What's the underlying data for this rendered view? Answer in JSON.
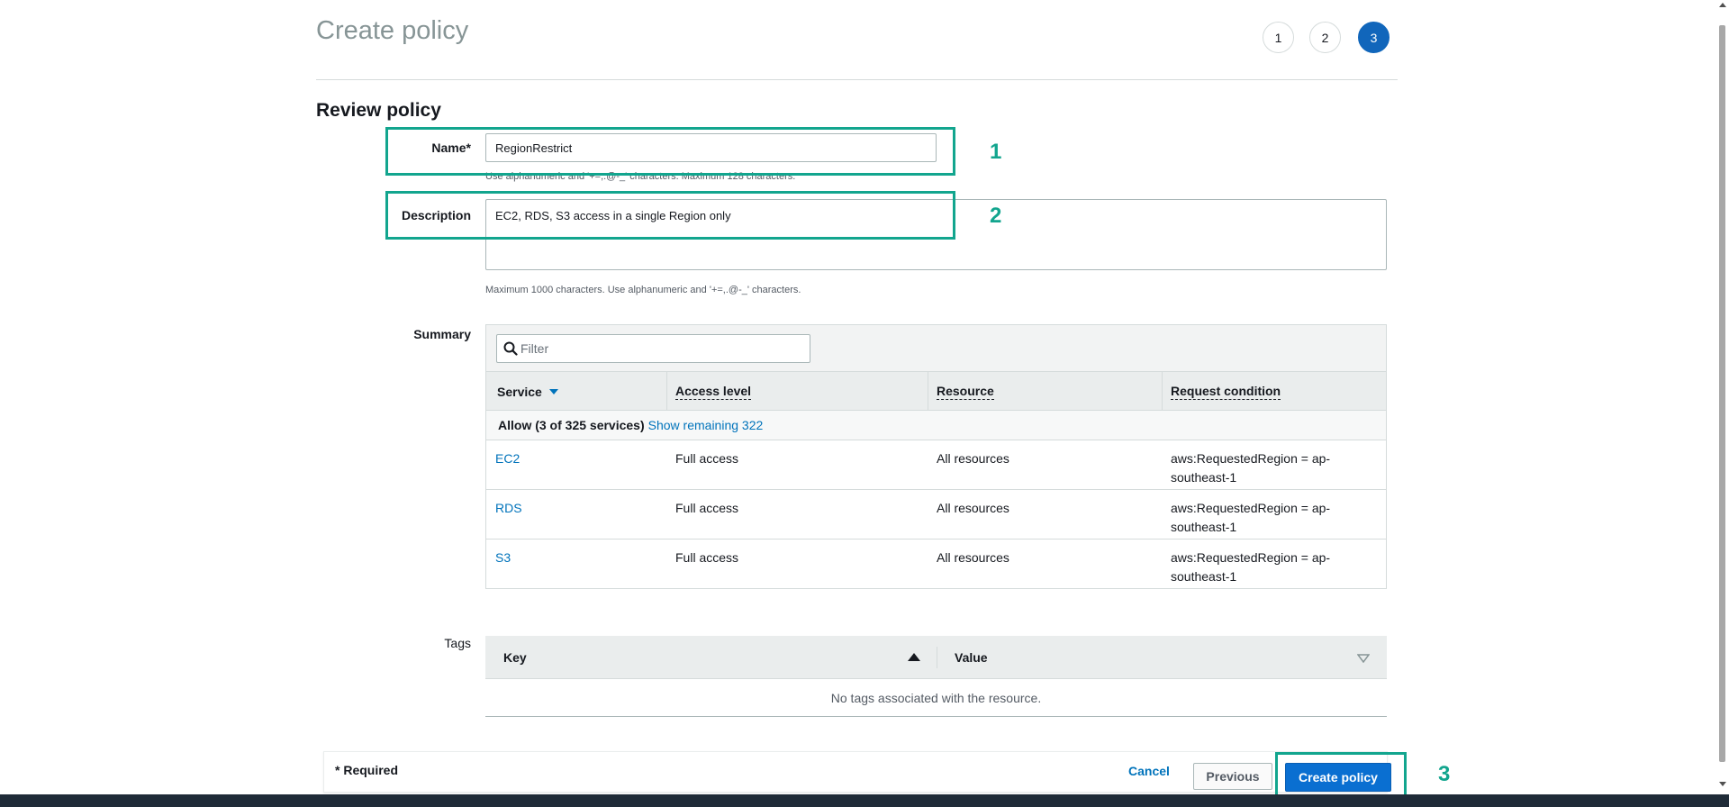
{
  "page": {
    "title": "Create policy"
  },
  "steps": [
    "1",
    "2",
    "3"
  ],
  "active_step": "3",
  "review": {
    "title": "Review policy",
    "name_label": "Name*",
    "name_value": "RegionRestrict",
    "name_help": "Use alphanumeric and '+=,.@-_' characters. Maximum 128 characters.",
    "description_label": "Description",
    "description_value": "EC2, RDS, S3 access in a single Region only",
    "description_help": "Maximum 1000 characters. Use alphanumeric and '+=,.@-_' characters."
  },
  "summary": {
    "label": "Summary",
    "filter_placeholder": "Filter",
    "columns": [
      "Service",
      "Access level",
      "Resource",
      "Request condition"
    ],
    "group_label": "Allow (3 of 325 services)",
    "group_link": "Show remaining 322",
    "rows": [
      {
        "service": "EC2",
        "access": "Full access",
        "resource": "All resources",
        "condition": "aws:RequestedRegion = ap-southeast-1"
      },
      {
        "service": "RDS",
        "access": "Full access",
        "resource": "All resources",
        "condition": "aws:RequestedRegion = ap-southeast-1"
      },
      {
        "service": "S3",
        "access": "Full access",
        "resource": "All resources",
        "condition": "aws:RequestedRegion = ap-southeast-1"
      }
    ]
  },
  "tags": {
    "label": "Tags",
    "key_header": "Key",
    "value_header": "Value",
    "empty_text": "No tags associated with the resource."
  },
  "footer": {
    "required_text": "* Required",
    "cancel_label": "Cancel",
    "previous_label": "Previous",
    "create_label": "Create policy"
  },
  "callouts": [
    "1",
    "2",
    "3"
  ],
  "colors": {
    "accent": "#0073bb",
    "callout": "#12a58e",
    "primary_button": "#0a6fd1"
  }
}
